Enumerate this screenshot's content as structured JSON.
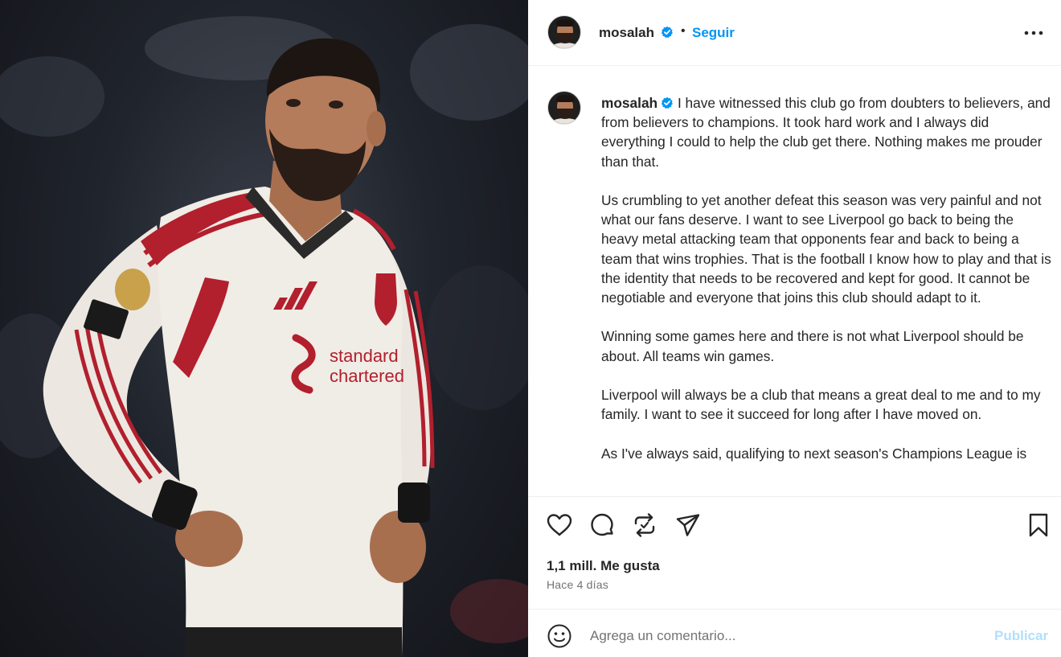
{
  "post": {
    "username": "mosalah",
    "follow_label": "Seguir",
    "separator": "•",
    "caption": "I have witnessed this club go from doubters to believers, and from believers to champions. It took hard work and I always did everything I could to help the club get there. Nothing makes me prouder than that.\n\nUs crumbling to yet another defeat this season was very painful and not what our fans deserve. I want to see Liverpool go back to being the heavy metal attacking team that opponents fear and back to being a team that wins trophies. That is the football I know how to play and that is the identity that needs to be recovered and kept for good. It cannot be negotiable and everyone that joins this club should adapt to it.\n\nWinning some games here and there is not what Liverpool should be about. All teams win games.\n\nLiverpool will always be a club that means a great deal to me and to my family. I want to see it succeed for long after I have moved on.\n\nAs I've always said, qualifying to next season's Champions League is",
    "likes": "1,1 mill. Me gusta",
    "time_ago": "Hace 4 días"
  },
  "comment": {
    "placeholder": "Agrega un comentario...",
    "publish_label": "Publicar"
  },
  "photo": {
    "shirt_sponsor_line1": "standard",
    "shirt_sponsor_line2": "chartered"
  },
  "icons": {
    "verified": "verified-badge-icon",
    "more": "more-options-icon",
    "like": "heart-icon",
    "comment": "comment-icon",
    "repost": "repost-icon",
    "share": "share-icon",
    "save": "bookmark-icon",
    "emoji": "emoji-icon"
  },
  "colors": {
    "accent": "#0095f6",
    "publish_disabled": "#b2dffc",
    "text": "#262626",
    "muted": "#737373",
    "divider": "#efefef"
  }
}
